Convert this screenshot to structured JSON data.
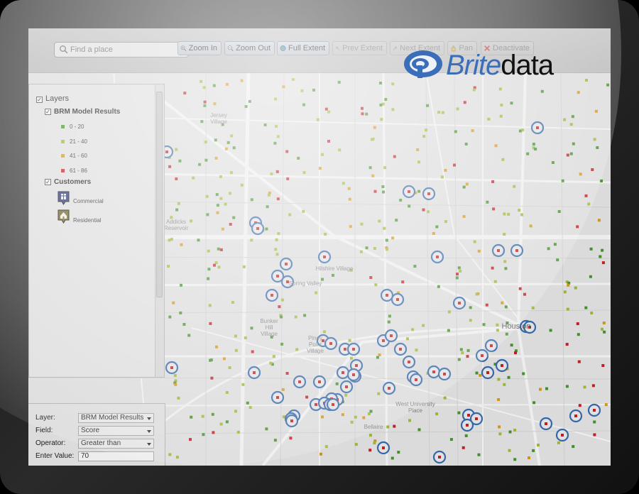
{
  "search": {
    "placeholder": "Find a place"
  },
  "toolbar": {
    "zoom_in": "Zoom In",
    "zoom_out": "Zoom Out",
    "full_extent": "Full Extent",
    "prev_extent": "Prev Extent",
    "next_extent": "Next Extent",
    "pan": "Pan",
    "deactivate": "Deactivate"
  },
  "logo": {
    "brite": "Brite",
    "data": "data"
  },
  "layers_panel": {
    "title": "Layers",
    "group1": {
      "label": "BRM Model Results",
      "legend": [
        {
          "label": "0 - 20",
          "color": "#4a9a2e"
        },
        {
          "label": "21 - 40",
          "color": "#a8c23a"
        },
        {
          "label": "41 - 60",
          "color": "#e0a020"
        },
        {
          "label": "61 - 86",
          "color": "#d0202a"
        }
      ]
    },
    "group2": {
      "label": "Customers",
      "items": [
        {
          "label": "Commercial",
          "icon": "commercial-building-icon"
        },
        {
          "label": "Residential",
          "icon": "residential-house-icon"
        }
      ]
    }
  },
  "query_panel": {
    "layer_label": "Layer:",
    "layer_value": "BRM Model Results",
    "field_label": "Field:",
    "field_value": "Score",
    "operator_label": "Operator:",
    "operator_value": "Greater than",
    "value_label": "Enter Value:",
    "value_value": "70"
  },
  "map_labels": {
    "jersey_village": "Jersey Village",
    "hilshire_village": "Hilshire Village",
    "spring_valley": "Spring Valley",
    "bunker_hill_village": "Bunker Hill Village",
    "piney_point_village": "Piney Point Village",
    "west_university_place": "West University Place",
    "bellaire": "Bellaire",
    "houston": "Houston",
    "addicks_reservoir": "Addicks Reservoir"
  },
  "colors": {
    "customer_ring": "#3a6fb5",
    "score_low": "#4a9a2e",
    "score_mid": "#a8c23a",
    "score_high": "#e0a020",
    "score_top": "#d0202a"
  }
}
